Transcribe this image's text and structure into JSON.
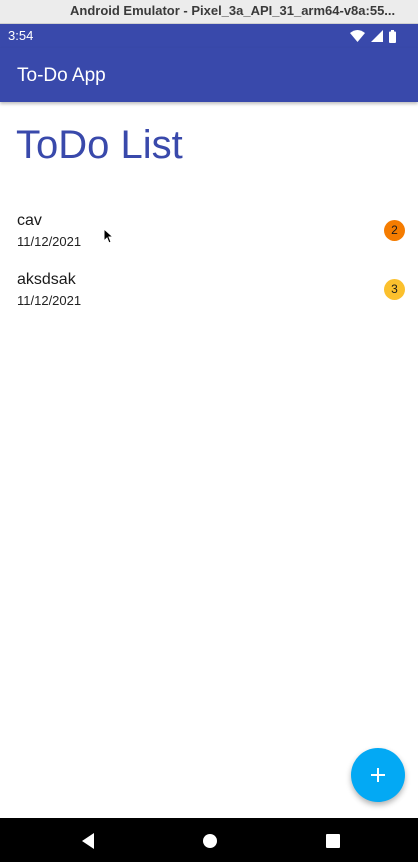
{
  "emulator": {
    "title": "Android Emulator - Pixel_3a_API_31_arm64-v8a:55..."
  },
  "statusbar": {
    "time": "3:54",
    "icons": [
      "wifi-icon",
      "cellular-signal-icon",
      "battery-icon"
    ]
  },
  "appbar": {
    "title": "To-Do App",
    "color": "#3949ab"
  },
  "main": {
    "page_title": "ToDo List",
    "todos": [
      {
        "name": "cav",
        "date": "11/12/2021",
        "priority": "2",
        "badge_color": "#f57c00"
      },
      {
        "name": "aksdsak",
        "date": "11/12/2021",
        "priority": "3",
        "badge_color": "#fbc02d"
      }
    ]
  },
  "fab": {
    "icon": "plus-icon",
    "color": "#03a9f4"
  },
  "navbar": {
    "buttons": [
      "back-icon",
      "home-icon",
      "recents-icon"
    ]
  }
}
